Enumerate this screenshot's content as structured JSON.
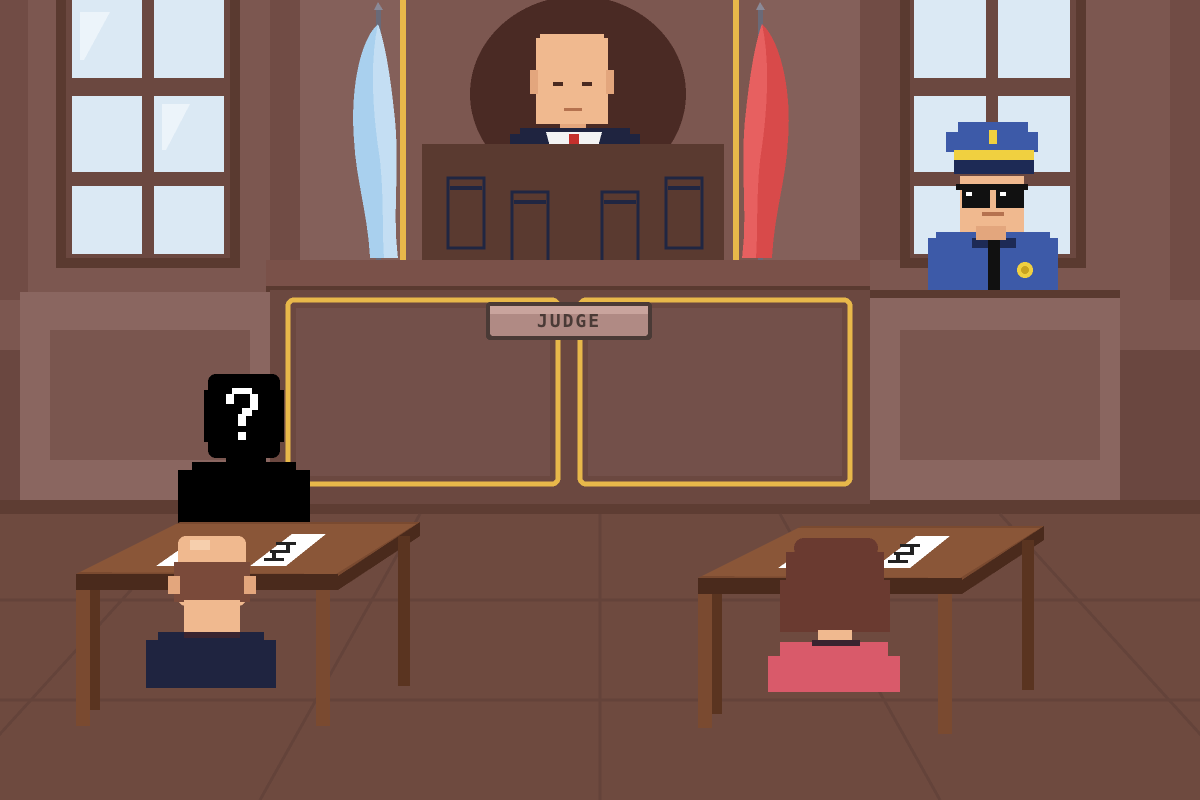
{
  "scene": {
    "name": "Courtroom",
    "judge_plate": "JUDGE"
  },
  "characters": {
    "judge": "judge",
    "police_officer": "police-officer",
    "mystery_witness": "unknown-person",
    "defendant": "bald-man",
    "plaintiff": "woman"
  },
  "icons": {
    "mystery": "question-mark-icon",
    "badge": "police-badge-icon",
    "sunglasses": "sunglasses-icon"
  },
  "colors": {
    "wall": "#7c5750",
    "floor": "#6e4a3f",
    "wood": "#5a3a30",
    "gold_trim": "#e8b84a",
    "flag_left": "#a9d0ee",
    "flag_right": "#d84a4a",
    "police_blue": "#3d5aa8",
    "plaintiff_pink": "#d95a6a"
  }
}
